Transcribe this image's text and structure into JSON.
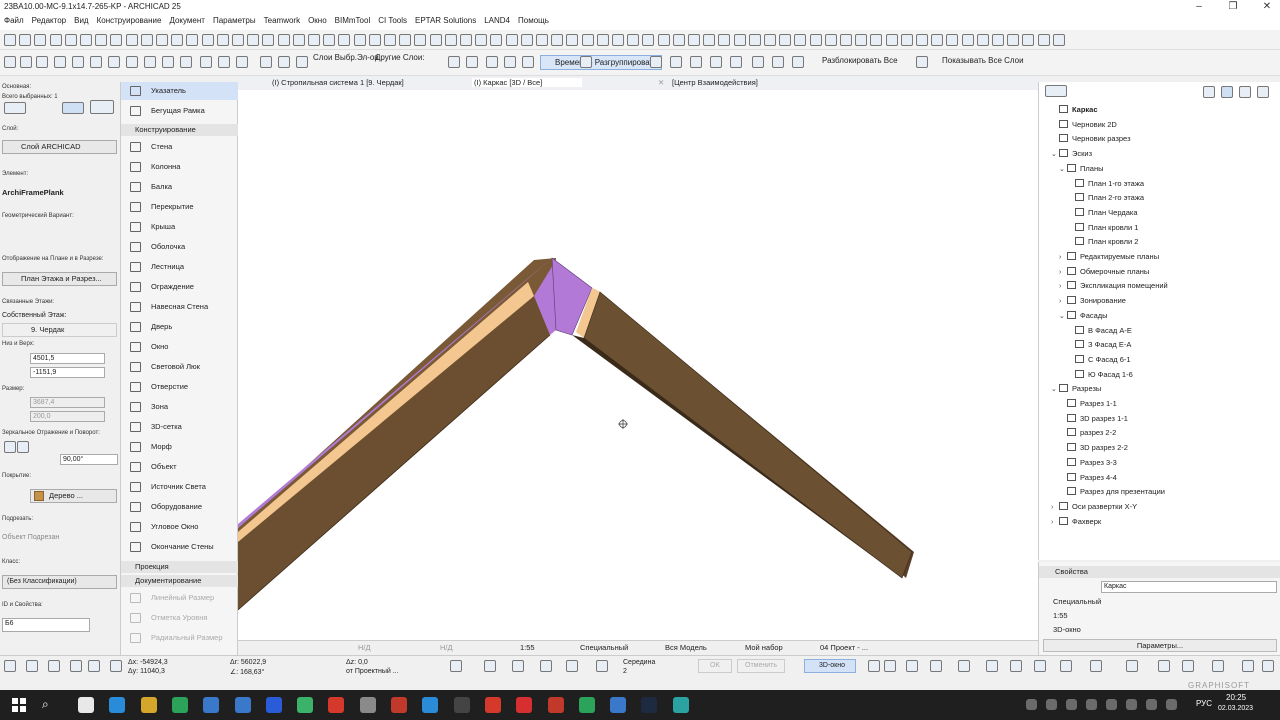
{
  "title": "23BA10.00-MC-9.1x14.7-265-KP - ARCHICAD 25",
  "menu": [
    "Файл",
    "Редактор",
    "Вид",
    "Конструирование",
    "Документ",
    "Параметры",
    "Teamwork",
    "Окно",
    "BIMmTool",
    "CI Tools",
    "EPTAR Solutions",
    "LAND4",
    "Помощь"
  ],
  "toolbar2": {
    "layers_select": "Слои Выбр.Эл-ов",
    "other_layers": "Другие Слои:",
    "temp_ungroup": "Временно Разгруппировать",
    "unlock_all": "Разблокировать Все",
    "show_all_layers": "Показывать Все Слои"
  },
  "infobox": {
    "main": "Основная:",
    "all_selected": "Всего выбранных: 1",
    "layer_label": "Слой:",
    "layer_value": "Слой ARCHICAD",
    "element_label": "Элемент:",
    "element_value": "ArchiFramePlank",
    "geometry_label": "Геометрический Вариант:",
    "display_label": "Отображение на Плане и в Разрезе:",
    "display_value": "План Этажа и Разрез...",
    "linked_label": "Связанные Этажи:",
    "own_floor_label": "Собственный Этаж:",
    "own_floor_value": "9. Чердак",
    "topbottom_label": "Низ и Верх:",
    "top_value": "4501,5",
    "bottom_value": "-1151,9",
    "size_label": "Размер:",
    "size1": "3687,4",
    "size2": "200,0",
    "mirror_label": "Зеркальное Отражение и Поворот:",
    "angle_value": "90,00°",
    "surface_label": "Покрытие:",
    "surface_value": "Дерево ...",
    "trim_label": "Подрезать:",
    "trim_value": "Объект Подрезан",
    "class_label": "Класс:",
    "class_value": "(Без Классификации)",
    "id_label": "ID и Свойства:",
    "id_value": "Б6"
  },
  "toolbox": {
    "pointer": "Указатель",
    "marquee": "Бегущая Рамка",
    "design_header": "Конструирование",
    "tools": [
      "Стена",
      "Колонна",
      "Балка",
      "Перекрытие",
      "Крыша",
      "Оболочка",
      "Лестница",
      "Ограждение",
      "Навесная Стена",
      "Дверь",
      "Окно",
      "Световой Люк",
      "Отверстие",
      "Зона",
      "3D-сетка",
      "Морф",
      "Объект",
      "Источник Света",
      "Оборудование",
      "Угловое Окно",
      "Окончание Стены"
    ],
    "projection_header": "Проекция",
    "doc_header": "Документирование",
    "doc_tools": [
      "Линейный Размер",
      "Отметка Уровня",
      "Радиальный Размер"
    ]
  },
  "tabs": [
    "(I) Стропильная система 1 [9. Чердак]",
    "(I) Каркас [3D / Все]",
    "[Центр Взаимодействия]"
  ],
  "viewbar": {
    "nd1": "Н/Д",
    "nd2": "Н/Д",
    "scale": "1:55",
    "special": "Специальный",
    "model": "Вся Модель",
    "myset": "Мой набор",
    "project": "04 Проект - ..."
  },
  "navigator": {
    "items": [
      {
        "label": "Каркас",
        "level": 0,
        "bold": true
      },
      {
        "label": "Черновик 2D",
        "level": 0
      },
      {
        "label": "Черновик разрез",
        "level": 0
      },
      {
        "label": "Эскиз",
        "level": 0,
        "exp": "v"
      },
      {
        "label": "Планы",
        "level": 1,
        "exp": "v"
      },
      {
        "label": "План 1-го этажа",
        "level": 2
      },
      {
        "label": "План 2-го этажа",
        "level": 2
      },
      {
        "label": "План Чердака",
        "level": 2
      },
      {
        "label": "План кровли 1",
        "level": 2
      },
      {
        "label": "План кровли 2",
        "level": 2
      },
      {
        "label": "Редактируемые планы",
        "level": 1,
        "exp": ">"
      },
      {
        "label": "Обмерочные планы",
        "level": 1,
        "exp": ">"
      },
      {
        "label": "Экспликация помещений",
        "level": 1,
        "exp": ">"
      },
      {
        "label": "Зонирование",
        "level": 1,
        "exp": ">"
      },
      {
        "label": "Фасады",
        "level": 1,
        "exp": "v"
      },
      {
        "label": "В Фасад А-Е",
        "level": 2
      },
      {
        "label": "З Фасад Е-А",
        "level": 2
      },
      {
        "label": "С Фасад 6-1",
        "level": 2
      },
      {
        "label": "Ю Фасад 1-6",
        "level": 2
      },
      {
        "label": "Разрезы",
        "level": 0,
        "exp": "v"
      },
      {
        "label": "Разрез 1-1",
        "level": 1
      },
      {
        "label": "3D разрез 1-1",
        "level": 1
      },
      {
        "label": "разрез 2-2",
        "level": 1
      },
      {
        "label": "3D разрез 2-2",
        "level": 1
      },
      {
        "label": "Разрез 3-3",
        "level": 1
      },
      {
        "label": "Разрез 4-4",
        "level": 1
      },
      {
        "label": "Разрез для презентации",
        "level": 1
      },
      {
        "label": "Оси развертки X-Y",
        "level": 0,
        "exp": ">"
      },
      {
        "label": "Фахверк",
        "level": 0,
        "exp": ">"
      }
    ]
  },
  "props": {
    "header": "Свойства",
    "name_value": "Каркас",
    "special": "Специальный",
    "scale": "1:55",
    "window": "3D-окно",
    "params_button": "Параметры..."
  },
  "bottom": {
    "dx": "Δx: -54924,3",
    "dy": "Δy: 11040,3",
    "ar": "Δr: 56022,9",
    "angle": "∠: 168,63°",
    "az": "Δz: 0,0",
    "from": "от Проектный ...",
    "middle": "Середина",
    "middle_n": "2",
    "ok": "OK",
    "cancel": "Отменить",
    "window3d": "3D-окно"
  },
  "watermark": "GRAPHISOFT",
  "clock": {
    "time": "20:25",
    "date": "02.03.2023",
    "lang": "РУС"
  },
  "colors": {
    "wood": "#6b5032",
    "wood_dark": "#4a3522",
    "insulation": "#f4c790",
    "membrane": "#b27ad6",
    "accent": "#3a78c9"
  }
}
